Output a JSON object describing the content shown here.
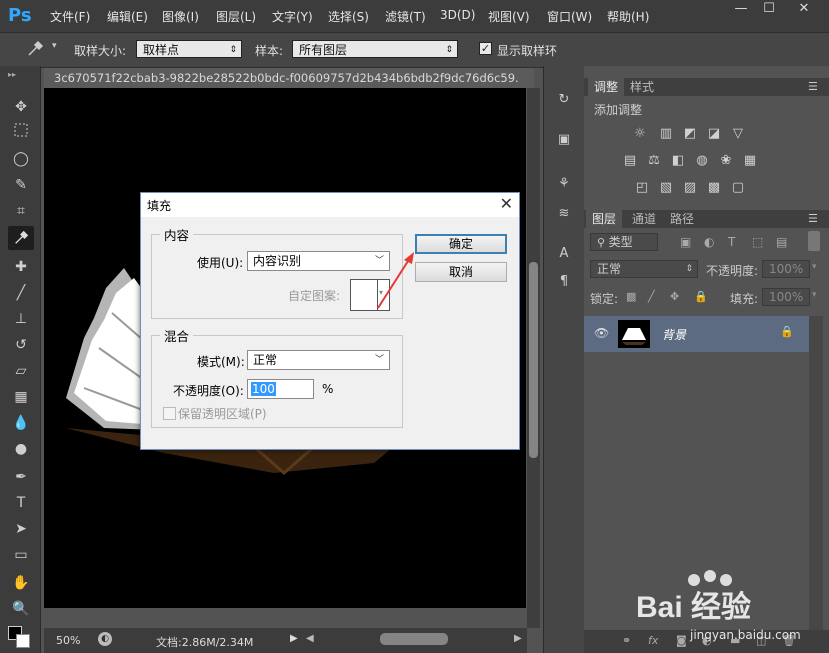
{
  "app": {
    "logo": "Ps"
  },
  "menu": [
    "文件(F)",
    "编辑(E)",
    "图像(I)",
    "图层(L)",
    "文字(Y)",
    "选择(S)",
    "滤镜(T)",
    "3D(D)",
    "视图(V)",
    "窗口(W)",
    "帮助(H)"
  ],
  "window_controls": {
    "minimize": "—",
    "maximize": "☐",
    "close": "✕"
  },
  "options": {
    "sample_size_label": "取样大小:",
    "sample_size_value": "取样点",
    "sample_label": "样本:",
    "sample_value": "所有图层",
    "show_ring_label": "显示取样环",
    "show_ring_checked": true
  },
  "document": {
    "tab_title": "3c670571f22cbab3-9822be28522b0bdc-f00609757d2b434b6bdb2f9dc76d6c59.",
    "zoom": "50%",
    "doc_info": "文档:2.86M/2.34M"
  },
  "adjustments_panel": {
    "tabs": [
      "调整",
      "样式"
    ],
    "add_label": "添加调整"
  },
  "layers_panel": {
    "tabs": [
      "图层",
      "通道",
      "路径"
    ],
    "filter_label": "类型",
    "blend_mode": "正常",
    "opacity_label": "不透明度:",
    "opacity_value": "100%",
    "lock_label": "锁定:",
    "fill_label": "填充:",
    "fill_value": "100%",
    "layer_name": "背景"
  },
  "dialog": {
    "title": "填充",
    "close": "✕",
    "content_group": "内容",
    "use_label": "使用(U):",
    "use_value": "内容识别",
    "custom_pattern_label": "自定图案:",
    "blend_group": "混合",
    "mode_label": "模式(M):",
    "mode_value": "正常",
    "opacity_label": "不透明度(O):",
    "opacity_value": "100",
    "opacity_unit": "%",
    "preserve_label": "保留透明区域(P)",
    "ok_label": "确定",
    "cancel_label": "取消"
  },
  "watermark": {
    "brand": "Bai 经验",
    "url": "jingyan.baidu.com"
  },
  "colors": {
    "ps_blue": "#31a8ff",
    "dialog_bg": "#f0f0f0",
    "annotation_arrow": "#e53935",
    "selected_layer": "#5c6b82"
  }
}
